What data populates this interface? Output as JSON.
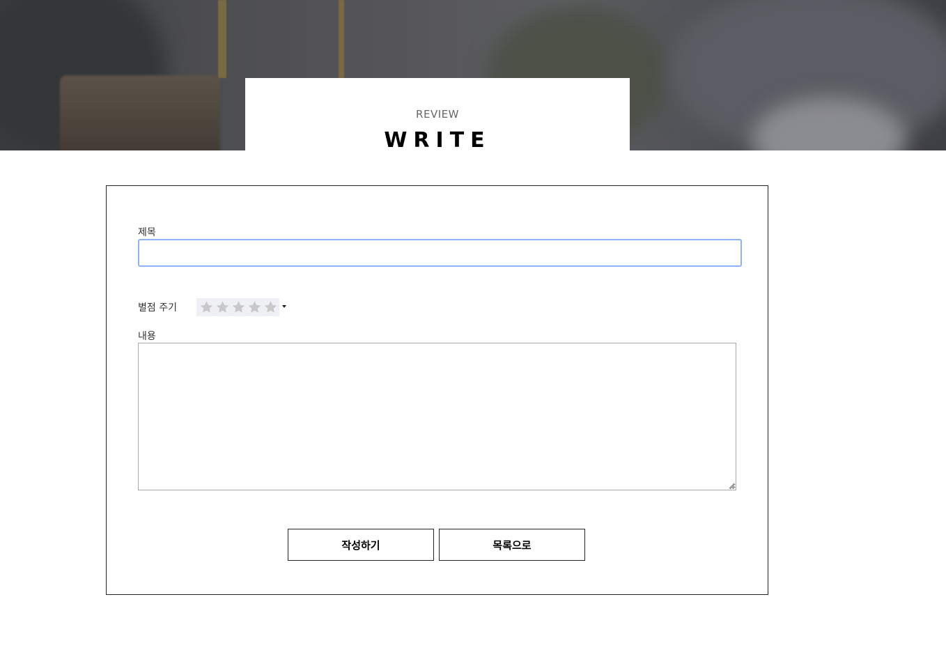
{
  "header": {
    "subtitle": "REVIEW",
    "title": "WRITE"
  },
  "form": {
    "title_label": "제목",
    "title_value": "",
    "rating_label": "별점 주기",
    "rating": {
      "value": 0,
      "max": 5,
      "star_icon": "star-icon",
      "empty_color": "#c8c8c8"
    },
    "content_label": "내용",
    "content_value": "",
    "submit_button": "작성하기",
    "list_button": "목록으로"
  },
  "colors": {
    "focus_border": "#8ab4f8",
    "border": "#222222"
  }
}
